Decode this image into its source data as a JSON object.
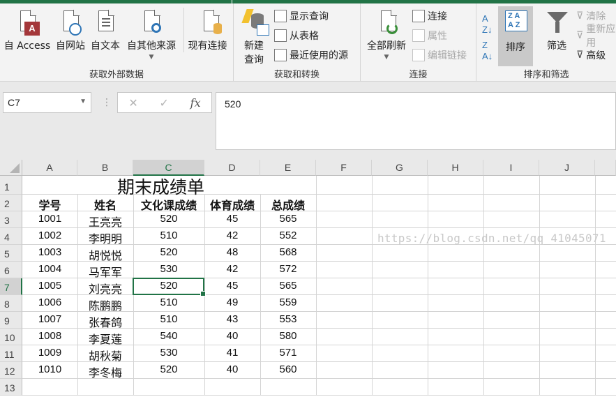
{
  "colors": {
    "accent": "#217346",
    "ribbon_bg": "#f3f3f3",
    "grid_line": "#d4d4d4"
  },
  "ribbon": {
    "get_external": {
      "label": "获取外部数据",
      "from_access": "自 Access",
      "from_web": "自网站",
      "from_text": "自文本",
      "from_other": "自其他来源",
      "existing": "现有连接"
    },
    "get_transform": {
      "label": "获取和转换",
      "new_query_line1": "新建",
      "new_query_line2": "查询",
      "show_queries": "显示查询",
      "from_table": "从表格",
      "recent_sources": "最近使用的源"
    },
    "connections": {
      "label": "连接",
      "refresh_all": "全部刷新",
      "connections": "连接",
      "properties": "属性",
      "edit_links": "编辑链接"
    },
    "sort_filter": {
      "label": "排序和筛选",
      "sort": "排序",
      "filter": "筛选",
      "clear": "清除",
      "reapply": "重新应用",
      "advanced": "高级"
    }
  },
  "formula_bar": {
    "name_box": "C7",
    "fx": "fx",
    "content": "520"
  },
  "sheet": {
    "columns": [
      "A",
      "B",
      "C",
      "D",
      "E",
      "F",
      "G",
      "H",
      "I",
      "J"
    ],
    "active_column": "C",
    "active_row": "7",
    "title": "期末成绩单",
    "headers": [
      "学号",
      "姓名",
      "文化课成绩",
      "体育成绩",
      "总成绩"
    ],
    "rows": [
      [
        "1001",
        "王亮亮",
        "520",
        "45",
        "565"
      ],
      [
        "1002",
        "李明明",
        "510",
        "42",
        "552"
      ],
      [
        "1003",
        "胡悦悦",
        "520",
        "48",
        "568"
      ],
      [
        "1004",
        "马军军",
        "530",
        "42",
        "572"
      ],
      [
        "1005",
        "刘亮亮",
        "520",
        "45",
        "565"
      ],
      [
        "1006",
        "陈鹏鹏",
        "510",
        "49",
        "559"
      ],
      [
        "1007",
        "张春鸽",
        "510",
        "43",
        "553"
      ],
      [
        "1008",
        "李夏莲",
        "540",
        "40",
        "580"
      ],
      [
        "1009",
        "胡秋菊",
        "530",
        "41",
        "571"
      ],
      [
        "1010",
        "李冬梅",
        "520",
        "40",
        "560"
      ]
    ],
    "row_numbers": [
      "1",
      "2",
      "3",
      "4",
      "5",
      "6",
      "7",
      "8",
      "9",
      "10",
      "11",
      "12",
      "13"
    ]
  },
  "watermark": "https://blog.csdn.net/qq_41045071"
}
